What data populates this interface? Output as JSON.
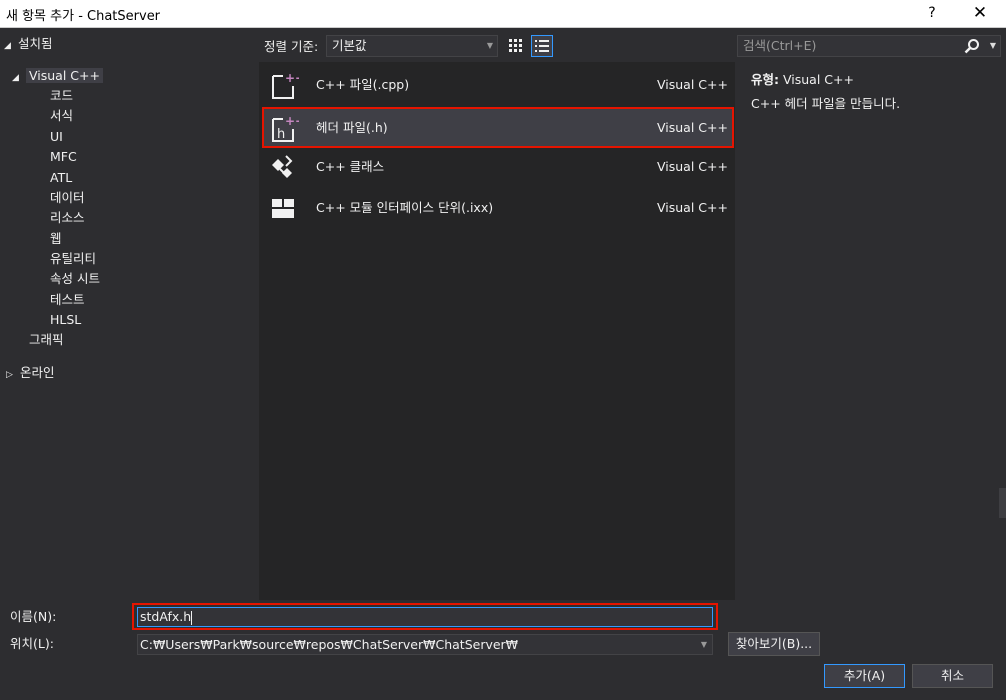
{
  "window": {
    "title": "새 항목 추가 - ChatServer",
    "help_label": "?",
    "close_label": "✕"
  },
  "tree": {
    "installed": "설치됨",
    "visual_cpp": "Visual C++",
    "children": [
      "코드",
      "서식",
      "UI",
      "MFC",
      "ATL",
      "데이터",
      "리소스",
      "웹",
      "유틸리티",
      "속성 시트",
      "테스트",
      "HLSL"
    ],
    "graphics": "그래픽",
    "online": "온라인"
  },
  "toolbar": {
    "sort_label": "정렬 기준:",
    "sort_value": "기본값",
    "search_placeholder": "검색(Ctrl+E)"
  },
  "templates": [
    {
      "name": "C++ 파일(.cpp)",
      "language": "Visual C++",
      "icon": "cpp-file-icon"
    },
    {
      "name": "헤더 파일(.h)",
      "language": "Visual C++",
      "icon": "header-file-icon"
    },
    {
      "name": "C++ 클래스",
      "language": "Visual C++",
      "icon": "cpp-class-icon"
    },
    {
      "name": "C++ 모듈 인터페이스 단위(.ixx)",
      "language": "Visual C++",
      "icon": "module-interface-icon"
    }
  ],
  "selected_template_index": 1,
  "description": {
    "type_label": "유형:",
    "type_value": "Visual C++",
    "text": "C++ 헤더 파일을 만듭니다."
  },
  "form": {
    "name_label": "이름(N):",
    "name_value": "stdAfx.h",
    "location_label": "위치(L):",
    "location_value": "C:₩Users₩Park₩source₩repos₩ChatServer₩ChatServer₩",
    "browse_label": "찾아보기(B)...",
    "add_label": "추가(A)",
    "cancel_label": "취소"
  },
  "colors": {
    "background": "#2d2d30",
    "list_background": "#252526",
    "selection": "#3f3f46",
    "highlight_outline": "#e51400",
    "focus_border": "#3399ff",
    "icon_accent": "#c586c0"
  }
}
